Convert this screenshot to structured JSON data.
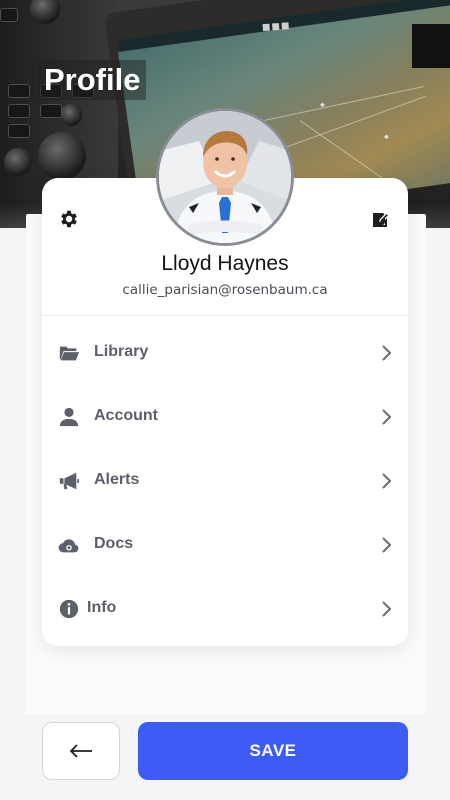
{
  "header": {
    "title": "Profile"
  },
  "profile": {
    "name": "Lloyd Haynes",
    "email": "callie_parisian@rosenbaum.ca",
    "avatar_icon": "avatar-photo"
  },
  "card_actions": {
    "settings_icon": "gear-icon",
    "edit_icon": "edit-icon"
  },
  "menu": {
    "items": [
      {
        "label": "Library",
        "icon": "folder-icon"
      },
      {
        "label": "Account",
        "icon": "user-icon"
      },
      {
        "label": "Alerts",
        "icon": "megaphone-icon"
      },
      {
        "label": "Docs",
        "icon": "cloud-icon"
      },
      {
        "label": "Info",
        "icon": "info-icon"
      }
    ]
  },
  "footer": {
    "back_icon": "arrow-left-icon",
    "save_label": "SAVE"
  },
  "colors": {
    "accent": "#3d5cf5",
    "icon_gray": "#5d6068",
    "background": "#f4f5f7"
  }
}
